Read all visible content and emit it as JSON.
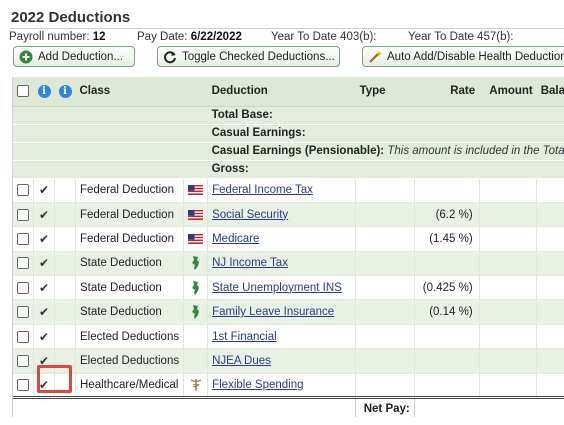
{
  "header": {
    "title": "2022 Deductions",
    "payroll_label": "Payroll number:",
    "payroll_value": "12",
    "paydate_label": "Pay Date:",
    "paydate_value": "6/22/2022",
    "ytd403": "Year To Date 403(b):",
    "ytd457": "Year To Date 457(b):"
  },
  "toolbar": {
    "add": "Add Deduction...",
    "toggle": "Toggle Checked Deductions...",
    "auto": "Auto Add/Disable Health Deductions..."
  },
  "table": {
    "headers": {
      "class": "Class",
      "deduction": "Deduction",
      "type": "Type",
      "rate": "Rate",
      "amount": "Amount",
      "balance": "Bala"
    },
    "summary": {
      "total_base": "Total Base:",
      "casual": "Casual Earnings:",
      "casual_pens": "Casual Earnings (Pensionable):",
      "casual_pens_note": "This amount is included in the Total",
      "gross": "Gross:"
    },
    "rows": [
      {
        "class": "Federal Deduction",
        "icon": "us-flag-icon",
        "deduction": "Federal Income Tax",
        "rate": ""
      },
      {
        "class": "Federal Deduction",
        "icon": "us-flag-icon",
        "deduction": "Social Security",
        "rate": "(6.2 %)"
      },
      {
        "class": "Federal Deduction",
        "icon": "us-flag-icon",
        "deduction": "Medicare",
        "rate": "(1.45 %)"
      },
      {
        "class": "State Deduction",
        "icon": "new-jersey-icon",
        "deduction": "NJ Income Tax",
        "rate": ""
      },
      {
        "class": "State Deduction",
        "icon": "new-jersey-icon",
        "deduction": "State Unemployment INS",
        "rate": "(0.425 %)"
      },
      {
        "class": "State Deduction",
        "icon": "new-jersey-icon",
        "deduction": "Family Leave Insurance",
        "rate": "(0.14 %)"
      },
      {
        "class": "Elected Deductions",
        "icon": "",
        "deduction": "1st Financial",
        "rate": ""
      },
      {
        "class": "Elected Deductions",
        "icon": "",
        "deduction": "NJEA Dues",
        "rate": ""
      },
      {
        "class": "Healthcare/Medical",
        "icon": "caduceus-icon",
        "deduction": "Flexible Spending",
        "rate": ""
      }
    ],
    "net_pay": "Net Pay:"
  },
  "colors": {
    "header_bg": "#dde9d6",
    "alt_row": "#e9f1e4",
    "link": "#2a3a8a",
    "highlight": "#e0443c",
    "info_icon": "#2f86d6"
  }
}
